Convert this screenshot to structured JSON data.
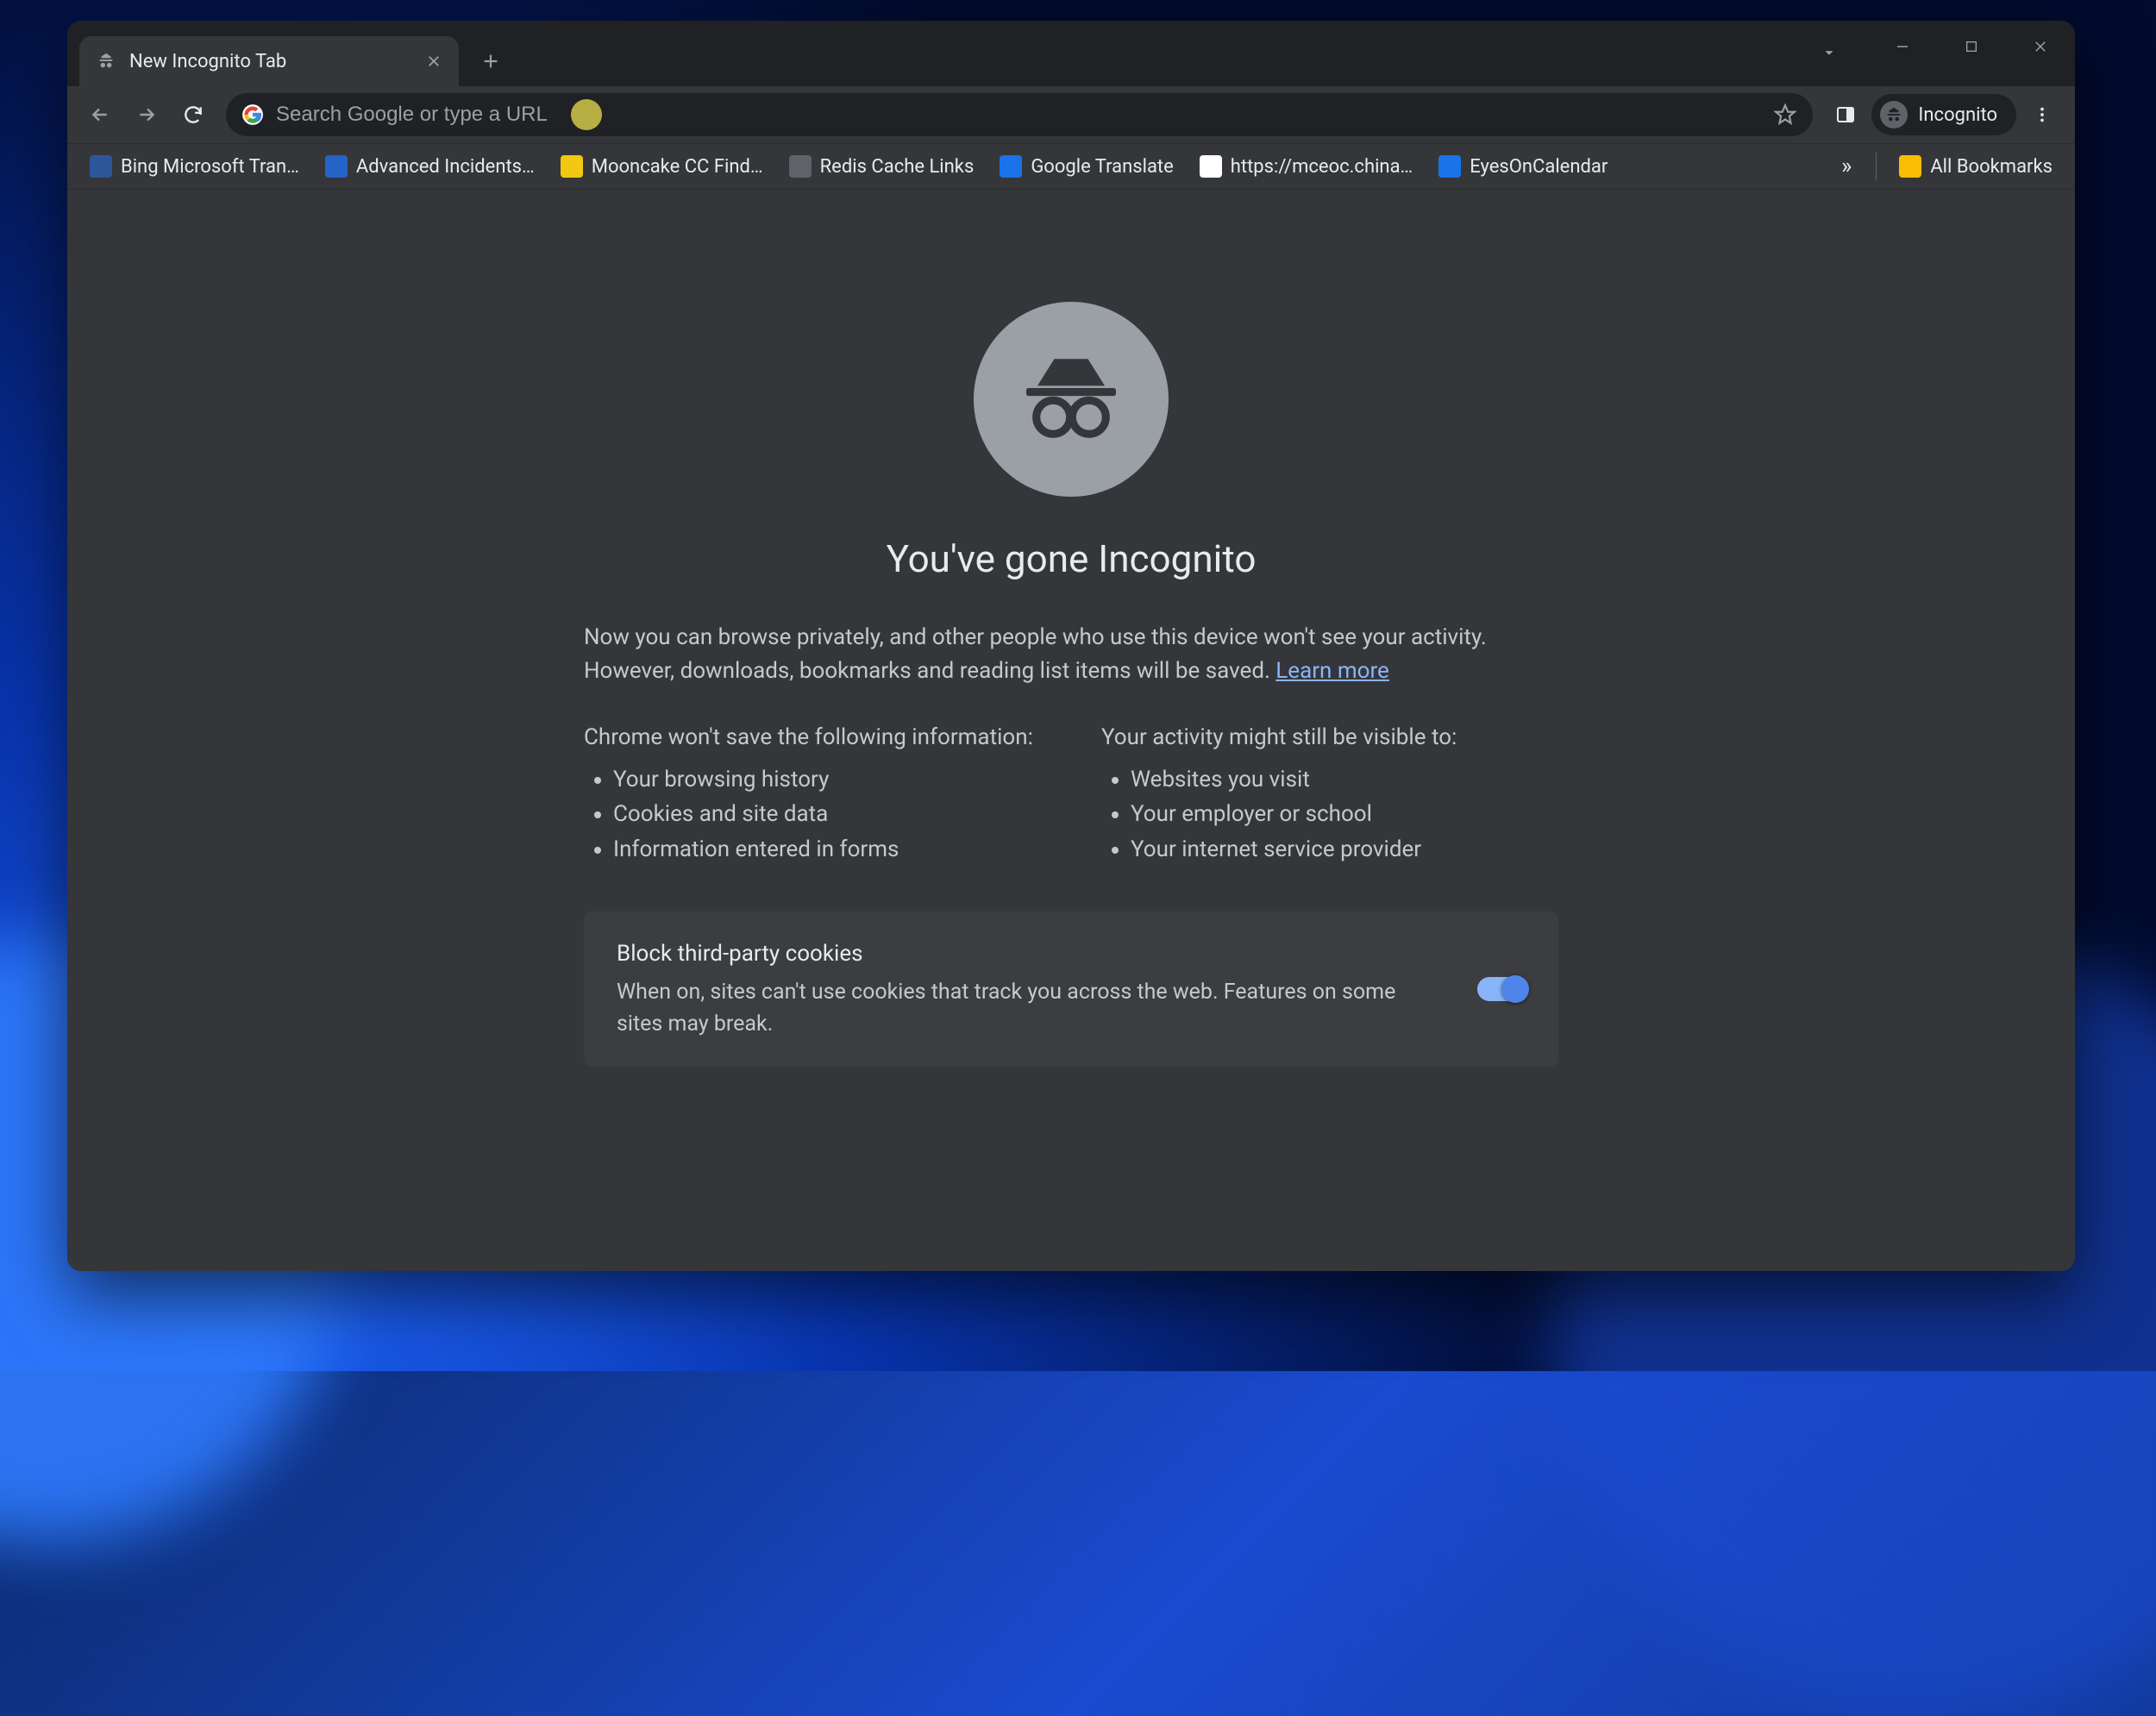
{
  "tab": {
    "title": "New Incognito Tab"
  },
  "omnibox": {
    "placeholder": "Search Google or type a URL"
  },
  "incognito_badge": "Incognito",
  "bookmarks": {
    "items": [
      {
        "label": "Bing Microsoft Tran…",
        "iconClass": "fc-blue"
      },
      {
        "label": "Advanced Incidents…",
        "iconClass": "fc-teal"
      },
      {
        "label": "Mooncake CC Find…",
        "iconClass": "fc-orange"
      },
      {
        "label": "Redis Cache Links",
        "iconClass": "fc-gray"
      },
      {
        "label": "Google Translate",
        "iconClass": "fc-gblue"
      },
      {
        "label": "https://mceoc.china…",
        "iconClass": "fc-white"
      },
      {
        "label": "EyesOnCalendar",
        "iconClass": "fc-gblue"
      }
    ],
    "overflow": "»",
    "all": "All Bookmarks"
  },
  "page": {
    "title": "You've gone Incognito",
    "intro_1": "Now you can browse privately, and other people who use this device won't see your activity. However, downloads, bookmarks and reading list items will be saved. ",
    "learn_more": "Learn more",
    "col1_title": "Chrome won't save the following information:",
    "col1_items": [
      "Your browsing history",
      "Cookies and site data",
      "Information entered in forms"
    ],
    "col2_title": "Your activity might still be visible to:",
    "col2_items": [
      "Websites you visit",
      "Your employer or school",
      "Your internet service provider"
    ],
    "cookie_title": "Block third-party cookies",
    "cookie_body": "When on, sites can't use cookies that track you across the web. Features on some sites may break."
  }
}
